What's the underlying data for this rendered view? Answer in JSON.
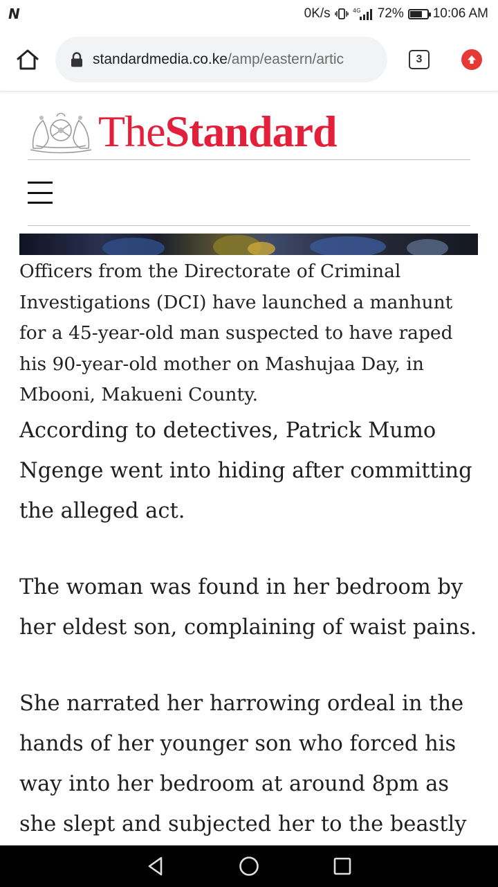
{
  "status_bar": {
    "network_speed": "0K/s",
    "network_type": "4G",
    "battery_percent": "72%",
    "battery_level": 0.72,
    "time": "10:06 AM",
    "icons": [
      "notification-n-icon",
      "vibrate-icon",
      "signal-icon",
      "battery-icon"
    ]
  },
  "browser": {
    "url_host": "standardmedia.co.ke",
    "url_path": "/amp/eastern/artic",
    "tab_count": "3",
    "icons": [
      "home-icon",
      "lock-icon",
      "tabs-icon",
      "update-icon"
    ],
    "accent_color": "#e53935"
  },
  "masthead": {
    "logo_the": "The",
    "logo_standard": "Standard",
    "brand_color": "#e3203b"
  },
  "article": {
    "caption": "Officers from the Directorate of Criminal Investigations (DCI) have launched a manhunt for a 45-year-old man suspected to have raped his 90-year-old mother on Mashujaa Day, in Mbooni, Makueni County.",
    "paragraphs": [
      "According to detectives, Patrick Mumo Ngenge went into hiding after committing the alleged act.",
      "The woman was found in her bedroom by her eldest son, complaining of waist pains.",
      "She narrated her harrowing ordeal in the hands of her younger son who forced his way into her bedroom at around 8pm as she slept and subjected her to the beastly"
    ]
  },
  "nav_bar": {
    "icons": [
      "back-icon",
      "home-circle-icon",
      "recents-icon"
    ]
  }
}
